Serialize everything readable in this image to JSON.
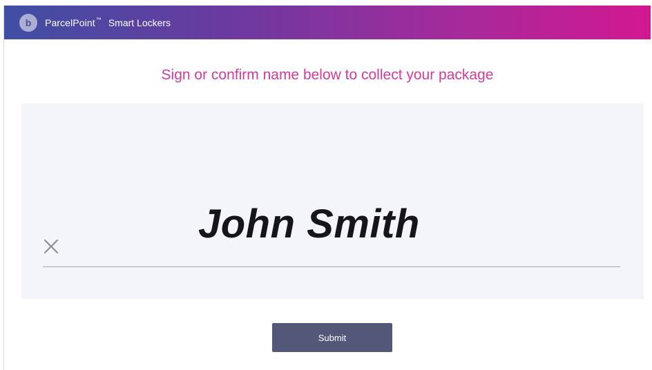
{
  "header": {
    "logo_glyph": "b",
    "brand": "ParcelPoint",
    "trademark": "™",
    "product": "Smart Lockers",
    "gradient_start": "#3f4fa3",
    "gradient_end": "#d31891"
  },
  "instruction": "Sign or confirm name below to collect your package",
  "signature": {
    "name": "John Smith",
    "clear_icon": "close-icon"
  },
  "actions": {
    "submit_label": "Submit"
  },
  "colors": {
    "accent": "#d23b9c",
    "button": "#535878",
    "signature_bg": "#f4f5f9"
  }
}
